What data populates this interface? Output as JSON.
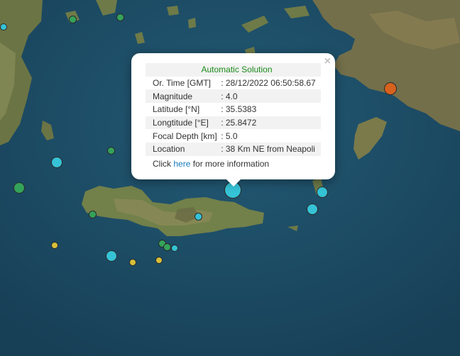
{
  "popup": {
    "heading": "Automatic Solution",
    "close_symbol": "×",
    "rows": [
      {
        "label": "Or. Time [GMT]",
        "value": ": 28/12/2022 06:50:58.67"
      },
      {
        "label": "Magnitude",
        "value": ": 4.0"
      },
      {
        "label": "Latitude [°N]",
        "value": ": 35.5383"
      },
      {
        "label": "Longtitude [°E]",
        "value": ": 25.8472"
      },
      {
        "label": "Focal Depth [km]",
        "value": ": 5.0"
      },
      {
        "label": "Location",
        "value": ": 38 Km NE from Neapoli"
      }
    ],
    "link_prefix": "Click ",
    "link_text": "here",
    "link_suffix": " for more information"
  },
  "colors": {
    "sea": "#1d4e68",
    "land": "#6e7a48",
    "marker_cyan": "#35c3d6",
    "marker_green": "#34a35a",
    "marker_yellow": "#d8bf3a",
    "marker_orange": "#d6621e",
    "heading_green": "#1a8a1a",
    "link_blue": "#1a7bbf"
  }
}
